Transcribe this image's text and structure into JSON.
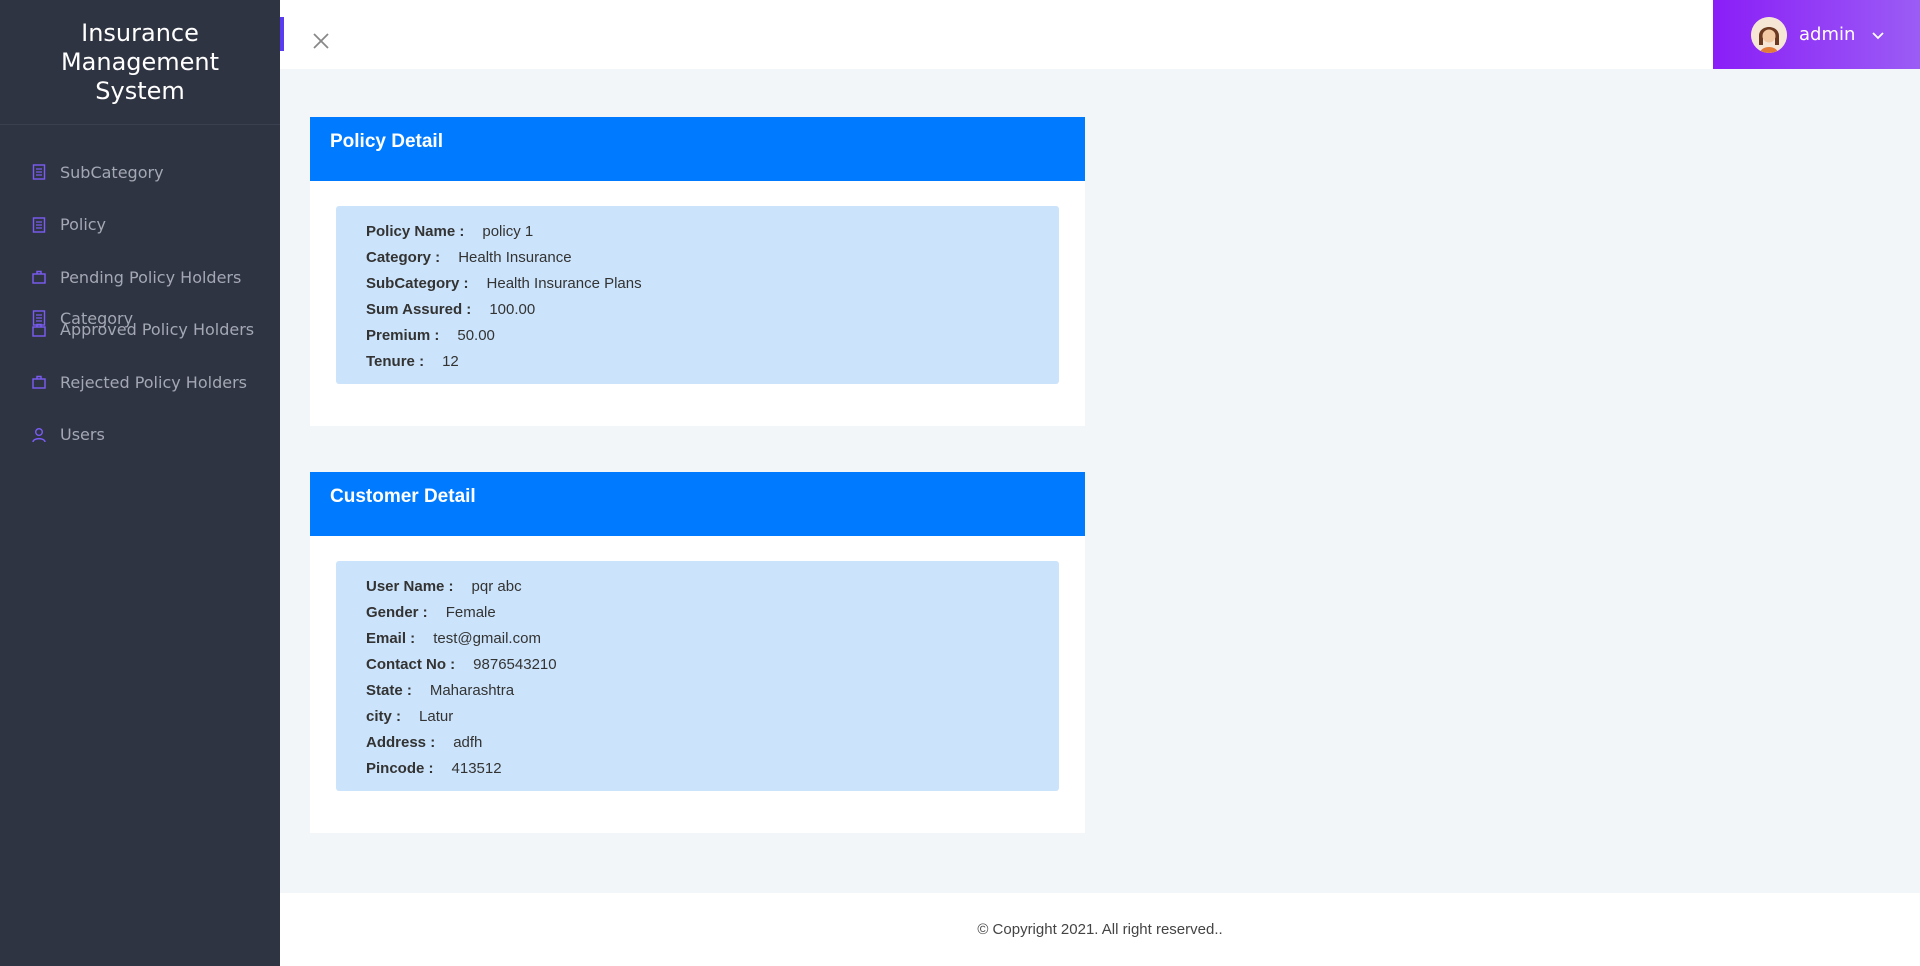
{
  "brand": {
    "line1": "Insurance",
    "line2": "Management",
    "line3": "System"
  },
  "sidebar": {
    "items": [
      {
        "label": "Category",
        "icon": "document-icon"
      },
      {
        "label": "SubCategory",
        "icon": "document-icon"
      },
      {
        "label": "Policy",
        "icon": "document-icon"
      },
      {
        "label": "Pending Policy Holders",
        "icon": "briefcase-icon"
      },
      {
        "label": "Approved Policy Holders",
        "icon": "briefcase-icon"
      },
      {
        "label": "Rejected Policy Holders",
        "icon": "briefcase-icon"
      },
      {
        "label": "Users",
        "icon": "user-icon"
      }
    ]
  },
  "topbar": {
    "user": "admin"
  },
  "policy": {
    "title": "Policy Detail",
    "rows": [
      {
        "label": "Policy Name :",
        "value": "policy 1"
      },
      {
        "label": "Category :",
        "value": "Health Insurance"
      },
      {
        "label": "SubCategory :",
        "value": "Health Insurance Plans"
      },
      {
        "label": "Sum Assured :",
        "value": "100.00"
      },
      {
        "label": "Premium :",
        "value": "50.00"
      },
      {
        "label": "Tenure :",
        "value": "12"
      }
    ]
  },
  "customer": {
    "title": "Customer Detail",
    "rows": [
      {
        "label": "User Name :",
        "value": "pqr abc"
      },
      {
        "label": "Gender :",
        "value": "Female"
      },
      {
        "label": "Email :",
        "value": "test@gmail.com"
      },
      {
        "label": "Contact No :",
        "value": "9876543210"
      },
      {
        "label": "State :",
        "value": "Maharashtra"
      },
      {
        "label": "city :",
        "value": "Latur"
      },
      {
        "label": "Address :",
        "value": "adfh"
      },
      {
        "label": "Pincode :",
        "value": "413512"
      }
    ]
  },
  "footer": {
    "text": "© Copyright 2021. All right reserved.."
  },
  "colors": {
    "sidebar": "#2f3442",
    "accent": "#007bff",
    "user_menu": "#8a1ef7",
    "detail_bg": "#cce4fb"
  }
}
